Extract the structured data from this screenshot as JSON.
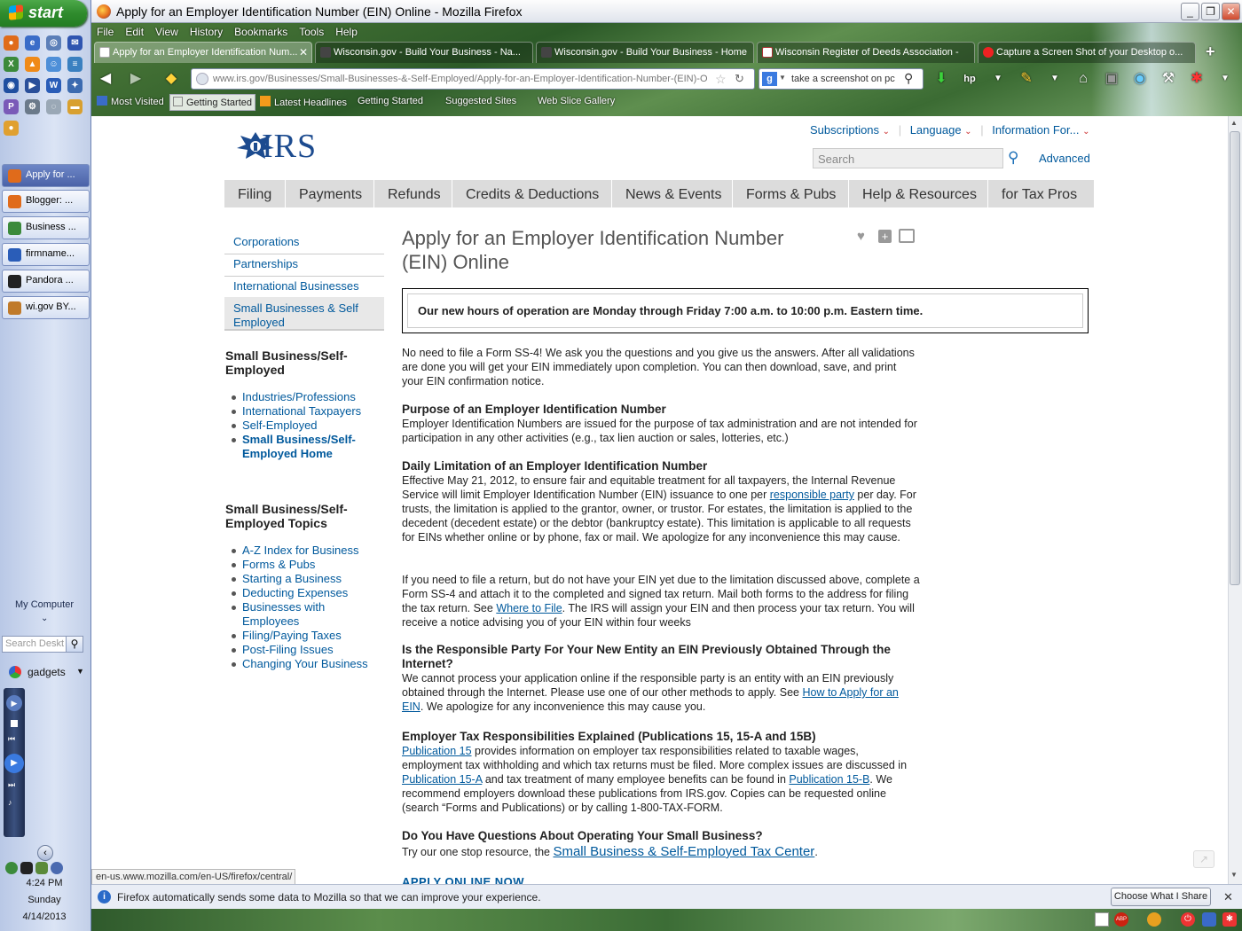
{
  "taskbar": {
    "start_label": "start",
    "tasks": [
      "Apply for ...",
      "Blogger: ...",
      "Business ...",
      "firmname...",
      "Pandora ...",
      "wi.gov BY..."
    ],
    "my_computer": "My Computer",
    "search_placeholder": "Search Deskt",
    "gadgets": "gadgets",
    "clock_time": "4:24 PM",
    "clock_day": "Sunday",
    "clock_date": "4/14/2013"
  },
  "window": {
    "title": "Apply for an Employer Identification Number (EIN) Online - Mozilla Firefox"
  },
  "menu": [
    "File",
    "Edit",
    "View",
    "History",
    "Bookmarks",
    "Tools",
    "Help"
  ],
  "tabs": [
    "Apply for an Employer Identification Num...",
    "Wisconsin.gov - Build Your Business - Na...",
    "Wisconsin.gov - Build Your Business - Home",
    "Wisconsin Register of Deeds Association -",
    "Capture a Screen Shot of your Desktop o..."
  ],
  "urlbar": {
    "url": "www.irs.gov/Businesses/Small-Businesses-&-Self-Employed/Apply-for-an-Employer-Identification-Number-(EIN)-O"
  },
  "searchbar": {
    "value": "take a screenshot on pc"
  },
  "bookmarks": [
    "Most Visited",
    "Getting Started",
    "Latest Headlines",
    "Getting Started",
    "Suggested Sites",
    "Web Slice Gallery"
  ],
  "irs": {
    "logo": "IRS",
    "utility": [
      "Subscriptions",
      "Language",
      "Information For..."
    ],
    "search_placeholder": "Search",
    "advanced": "Advanced",
    "nav": [
      "Filing",
      "Payments",
      "Refunds",
      "Credits & Deductions",
      "News & Events",
      "Forms & Pubs",
      "Help & Resources",
      "for Tax Pros"
    ],
    "leftnav": [
      "Corporations",
      "Partnerships",
      "International Businesses",
      "Small Businesses & Self Employed"
    ],
    "side1_heading": "Small Business/Self-Employed",
    "side1_links": [
      "Industries/Professions",
      "International Taxpayers",
      "Self-Employed",
      "Small Business/Self-Employed Home"
    ],
    "side2_heading": "Small Business/Self-Employed Topics",
    "side2_links": [
      "A-Z Index for Business",
      "Forms & Pubs",
      "Starting a Business",
      "Deducting Expenses",
      "Businesses with Employees",
      "Filing/Paying Taxes",
      "Post-Filing Issues",
      "Changing Your Business"
    ],
    "page_title": "Apply for an Employer Identification Number (EIN) Online",
    "notice": "Our new hours of operation are Monday through Friday 7:00 a.m. to 10:00 p.m. Eastern time.",
    "intro": "No need to file a Form SS-4! We ask you the questions and you give us the answers. After all validations are done you will get your EIN immediately upon completion. You can then download, save, and print your EIN confirmation notice.",
    "h_purpose": "Purpose of an Employer Identification Number",
    "p_purpose": "Employer Identification Numbers are issued for the purpose of tax administration and are not intended for participation in any other activities (e.g., tax lien auction or sales, lotteries, etc.)",
    "h_daily": "Daily Limitation of an Employer Identification Number",
    "p_daily_1": "Effective May 21, 2012, to ensure fair and equitable treatment for all taxpayers, the Internal Revenue Service will limit Employer Identification Number (EIN) issuance to one per ",
    "p_daily_link": "responsible party",
    "p_daily_2": " per day. For trusts, the limitation is applied to the grantor, owner, or trustor. For estates, the limitation is applied to the decedent (decedent estate) or the debtor (bankruptcy estate). This limitation is applicable to all requests for EINs whether online or by phone, fax or mail. We apologize for any inconvenience this may cause.",
    "p_return_1": "If you need to file a return, but do not have your EIN yet due to the limitation discussed above, complete a Form SS-4 and attach it to the completed and signed tax return. Mail both forms to the address for filing the tax return. See ",
    "p_return_link": "Where to File",
    "p_return_2": ". The IRS will assign your EIN and then process your tax return. You will receive a notice advising you of your EIN within four weeks",
    "h_resp": "Is the Responsible Party For Your New Entity an EIN Previously Obtained Through the Internet?",
    "p_resp_1": "We cannot process your application online if the responsible party is an entity with an EIN previously obtained through the Internet. Please use one of our other methods to apply. See ",
    "p_resp_link": "How to Apply for an EIN",
    "p_resp_2": ". We apologize for any inconvenience this may cause you.",
    "h_emp": "Employer Tax Responsibilities Explained (Publications 15, 15-A and 15B)",
    "p_emp_link1": "Publication 15",
    "p_emp_1": " provides information on employer tax responsibilities related to taxable wages, employment tax withholding and which tax returns must be filed.  More complex issues are discussed in ",
    "p_emp_link2": "Publication 15-A",
    "p_emp_2": " and tax treatment of many employee benefits can be found in ",
    "p_emp_link3": "Publication 15-B",
    "p_emp_3": ".  We recommend employers download these publications from IRS.gov.  Copies can be requested online (search “Forms and Publications) or by calling 1-800-TAX-FORM.",
    "h_q": "Do You Have Questions About Operating Your Small Business?",
    "p_q_1": "Try our one stop resource, the ",
    "p_q_link": "Small Business & Self-Employed Tax Center",
    "p_q_2": ".",
    "apply_now": "APPLY ONLINE NOW"
  },
  "status": "en-us.www.mozilla.com/en-US/firefox/central/",
  "notification": {
    "text": "Firefox automatically sends some data to Mozilla so that we can improve your experience.",
    "button": "Choose What I Share"
  }
}
